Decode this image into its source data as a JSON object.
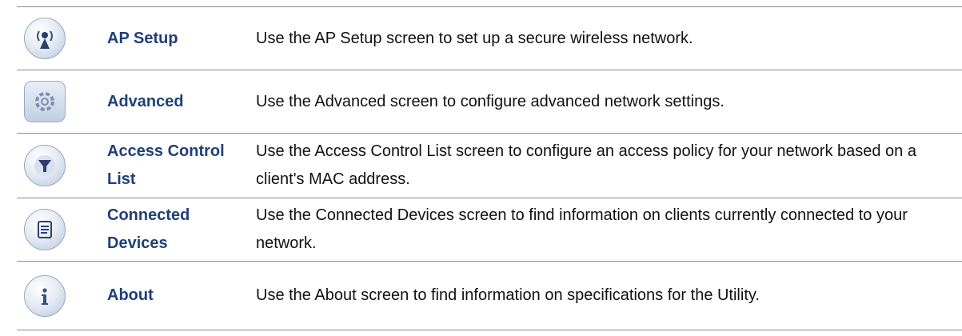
{
  "rows": [
    {
      "icon": "ap-setup-icon",
      "name": "AP Setup",
      "description": "Use the AP Setup screen to set up a secure wireless network."
    },
    {
      "icon": "advanced-settings-icon",
      "name": "Advanced",
      "description": "Use the Advanced screen to configure advanced network settings."
    },
    {
      "icon": "filter-icon",
      "name": "Access Control List",
      "description": "Use the Access Control List screen to configure an access policy for your network based on a client's MAC address."
    },
    {
      "icon": "document-list-icon",
      "name": "Connected Devices",
      "description": "Use the Connected Devices screen to find information on clients currently connected to your network."
    },
    {
      "icon": "info-icon",
      "name": "About",
      "description": "Use the About screen to find information on specifications for the Utility."
    }
  ],
  "colors": {
    "name_text": "#1f3f7a",
    "body_text": "#111111",
    "rule": "#8a8a8a"
  }
}
